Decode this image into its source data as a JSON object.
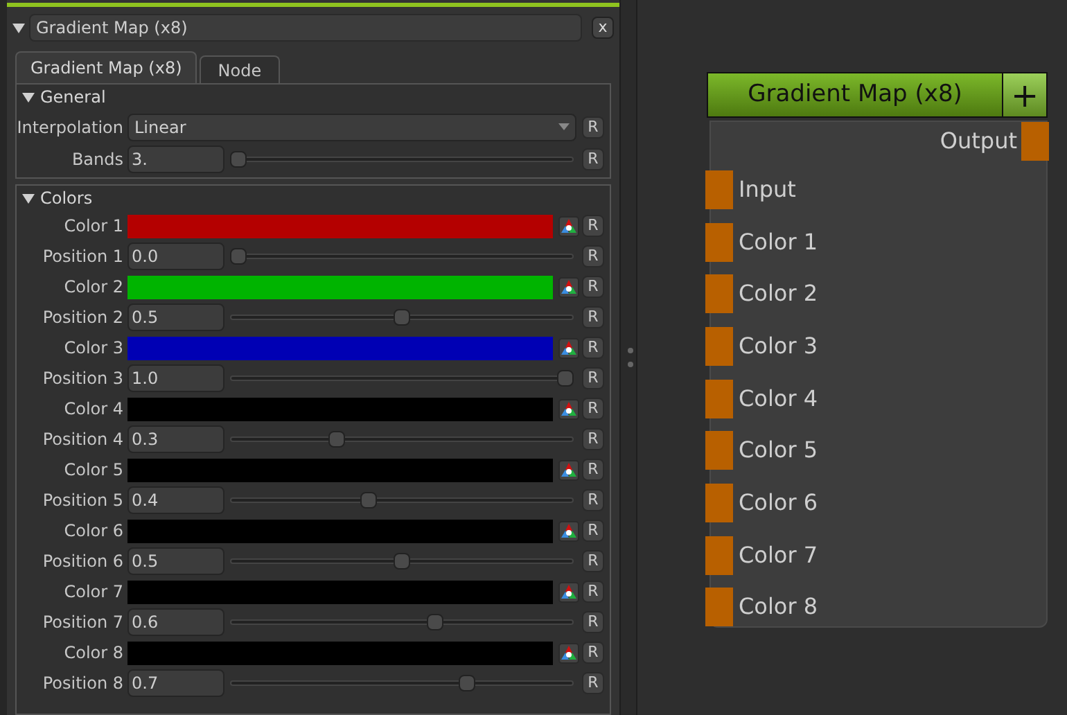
{
  "panel": {
    "title": "Gradient Map (x8)",
    "expanded": true,
    "close": "x"
  },
  "tabs": [
    {
      "label": "Gradient Map (x8)",
      "selected": true
    },
    {
      "label": "Node",
      "selected": false
    }
  ],
  "groups": [
    {
      "title": "General",
      "expanded": true,
      "rows": [
        {
          "kind": "dropdown",
          "label": "Interpolation",
          "value": "Linear",
          "reset": "R"
        },
        {
          "kind": "slider",
          "label": "Bands",
          "value": "3.",
          "level": 0,
          "reset": "R"
        }
      ]
    },
    {
      "title": "Colors",
      "expanded": true,
      "rows": [
        {
          "kind": "color",
          "label": "Color 1",
          "color": "#b40000",
          "reset": "R"
        },
        {
          "kind": "slider",
          "label": "Position 1",
          "value": "0.0",
          "level": 0,
          "reset": "R"
        },
        {
          "kind": "color",
          "label": "Color 2",
          "color": "#00b400",
          "reset": "R"
        },
        {
          "kind": "slider",
          "label": "Position 2",
          "value": "0.5",
          "level": 0.5,
          "reset": "R"
        },
        {
          "kind": "color",
          "label": "Color 3",
          "color": "#0000b4",
          "reset": "R"
        },
        {
          "kind": "slider",
          "label": "Position 3",
          "value": "1.0",
          "level": 1,
          "reset": "R"
        },
        {
          "kind": "color",
          "label": "Color 4",
          "color": "#000000",
          "reset": "R"
        },
        {
          "kind": "slider",
          "label": "Position 4",
          "value": "0.3",
          "level": 0.3,
          "reset": "R"
        },
        {
          "kind": "color",
          "label": "Color 5",
          "color": "#000000",
          "reset": "R"
        },
        {
          "kind": "slider",
          "label": "Position 5",
          "value": "0.4",
          "level": 0.4,
          "reset": "R"
        },
        {
          "kind": "color",
          "label": "Color 6",
          "color": "#000000",
          "reset": "R"
        },
        {
          "kind": "slider",
          "label": "Position 6",
          "value": "0.5",
          "level": 0.5,
          "reset": "R"
        },
        {
          "kind": "color",
          "label": "Color 7",
          "color": "#000000",
          "reset": "R"
        },
        {
          "kind": "slider",
          "label": "Position 7",
          "value": "0.6",
          "level": 0.6,
          "reset": "R"
        },
        {
          "kind": "color",
          "label": "Color 8",
          "color": "#000000",
          "reset": "R"
        },
        {
          "kind": "slider",
          "label": "Position 8",
          "value": "0.7",
          "level": 0.7,
          "reset": "R"
        }
      ]
    }
  ],
  "node": {
    "title": "Gradient Map (x8)",
    "add": "+",
    "output": "Output",
    "inputs": [
      "Input",
      "Color 1",
      "Color 2",
      "Color 3",
      "Color 4",
      "Color 5",
      "Color 6",
      "Color 7",
      "Color 8"
    ]
  }
}
